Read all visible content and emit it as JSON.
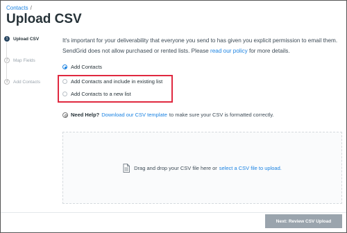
{
  "breadcrumb": {
    "parent": "Contacts",
    "separator": "/"
  },
  "page_title": "Upload CSV",
  "steps": [
    {
      "number": "1",
      "label": "Upload CSV",
      "active": true
    },
    {
      "number": "2",
      "label": "Map Fields",
      "active": false
    },
    {
      "number": "3",
      "label": "Add Contacts",
      "active": false
    }
  ],
  "intro": {
    "text_before_link": "It's important for your deliverability that everyone you send to has given you explicit permission to email them. SendGrid does not allow purchased or rented lists. Please ",
    "link": "read our policy",
    "text_after_link": " for more details."
  },
  "options": {
    "add_contacts": {
      "label": "Add Contacts",
      "checked": true
    },
    "add_existing_list": {
      "label": "Add Contacts and include in existing list",
      "checked": false
    },
    "add_new_list": {
      "label": "Add Contacts to a new list",
      "checked": false
    }
  },
  "help": {
    "title": "Need Help?",
    "link": "Download our CSV template",
    "text": "to make sure your CSV is formatted correctly."
  },
  "dropzone": {
    "text": "Drag and drop your CSV file here or",
    "link": "select a CSV file to upload."
  },
  "next_button": {
    "label": "Next: Review CSV Upload",
    "disabled": true
  },
  "colors": {
    "accent": "#1a82e2",
    "highlight": "#e0283f",
    "title": "#263238",
    "button_disabled": "#9aa4ad"
  }
}
